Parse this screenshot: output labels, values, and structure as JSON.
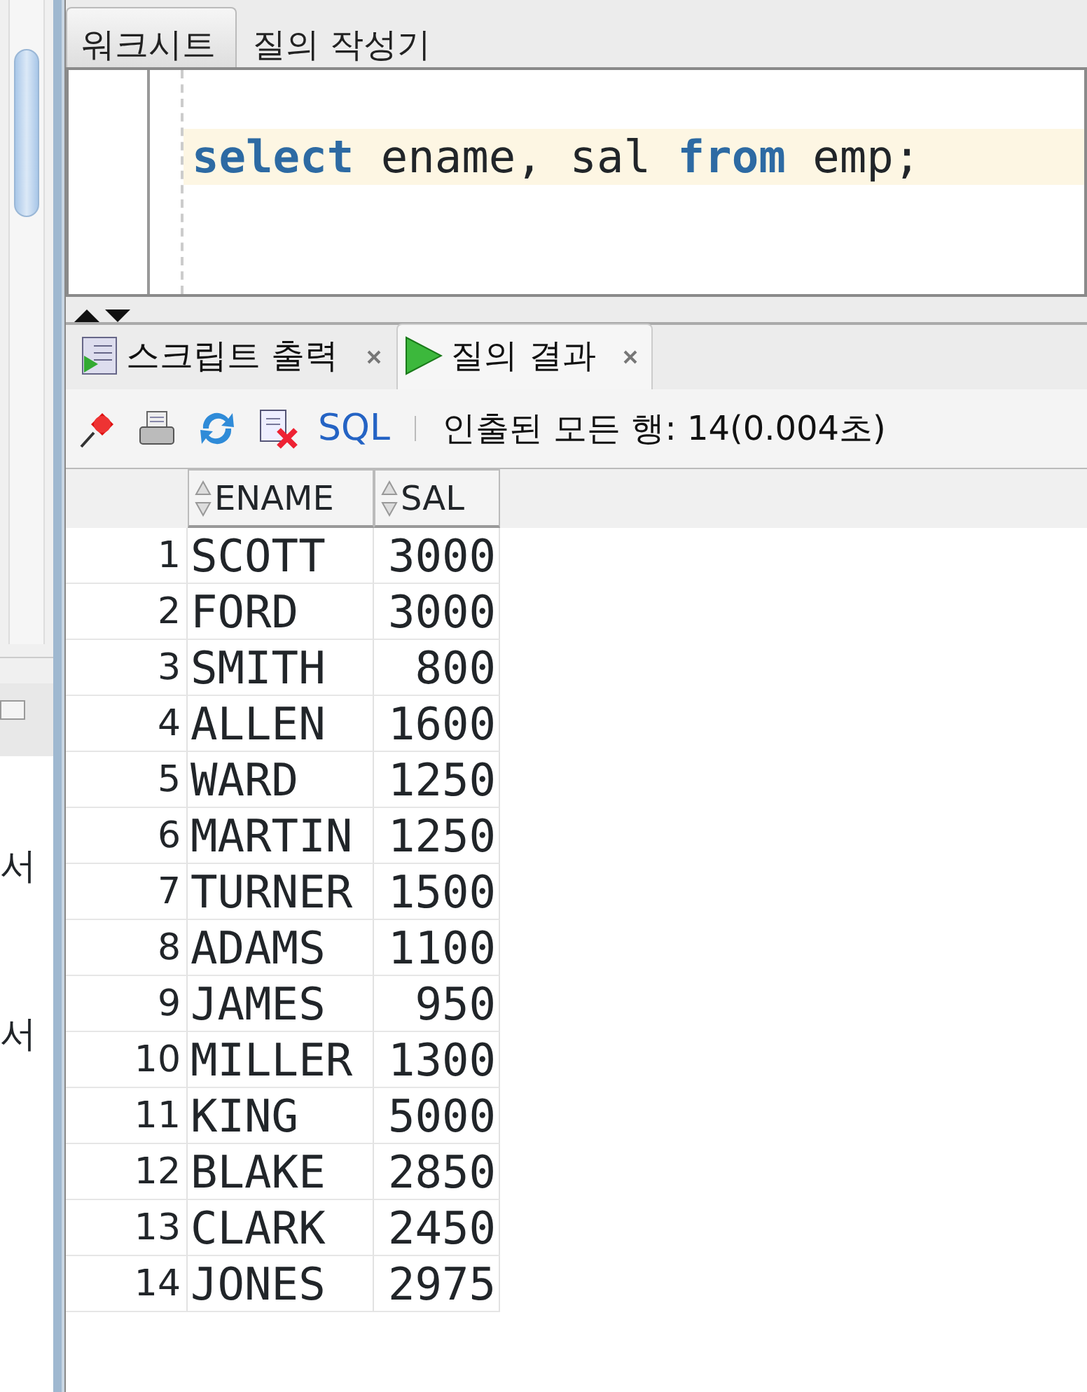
{
  "side_panel": {
    "texts": [
      "서",
      "서"
    ]
  },
  "editor_tabs": [
    {
      "label": "워크시트",
      "selected": true
    },
    {
      "label": "질의 작성기",
      "selected": false
    }
  ],
  "editor": {
    "tokens": [
      {
        "kind": "keyword",
        "text": "select"
      },
      {
        "kind": "plain",
        "text": " ename, sal "
      },
      {
        "kind": "keyword",
        "text": "from"
      },
      {
        "kind": "plain",
        "text": " emp;"
      }
    ]
  },
  "result_tabs": [
    {
      "label": "스크립트 출력",
      "selected": false,
      "kind": "script"
    },
    {
      "label": "질의 결과",
      "selected": true,
      "kind": "play"
    }
  ],
  "toolbar": {
    "sql_link": "SQL",
    "status": "인출된 모든 행: 14(0.004초)"
  },
  "grid": {
    "columns": [
      "ENAME",
      "SAL"
    ],
    "rows": [
      {
        "number": "1",
        "cells": [
          "SCOTT",
          "3000"
        ]
      },
      {
        "number": "2",
        "cells": [
          "FORD",
          "3000"
        ]
      },
      {
        "number": "3",
        "cells": [
          "SMITH",
          "800"
        ]
      },
      {
        "number": "4",
        "cells": [
          "ALLEN",
          "1600"
        ]
      },
      {
        "number": "5",
        "cells": [
          "WARD",
          "1250"
        ]
      },
      {
        "number": "6",
        "cells": [
          "MARTIN",
          "1250"
        ]
      },
      {
        "number": "7",
        "cells": [
          "TURNER",
          "1500"
        ]
      },
      {
        "number": "8",
        "cells": [
          "ADAMS",
          "1100"
        ]
      },
      {
        "number": "9",
        "cells": [
          "JAMES",
          "950"
        ]
      },
      {
        "number": "10",
        "cells": [
          "MILLER",
          "1300"
        ]
      },
      {
        "number": "11",
        "cells": [
          "KING",
          "5000"
        ]
      },
      {
        "number": "12",
        "cells": [
          "BLAKE",
          "2850"
        ]
      },
      {
        "number": "13",
        "cells": [
          "CLARK",
          "2450"
        ]
      },
      {
        "number": "14",
        "cells": [
          "JONES",
          "2975"
        ]
      }
    ]
  }
}
